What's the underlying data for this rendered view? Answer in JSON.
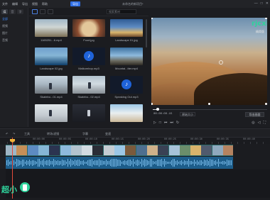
{
  "titlebar": {
    "menus": [
      "文件",
      "编辑",
      "导出",
      "视图",
      "帮助"
    ],
    "export_button": "导出",
    "title": "未命名的新项目*",
    "controls": [
      "—",
      "□",
      "✕"
    ]
  },
  "sidebar": {
    "tabs": [
      "媒",
      "音",
      "字"
    ],
    "items": [
      "全部",
      "视频",
      "图片",
      "音频"
    ]
  },
  "media": {
    "search_placeholder": "搜索素材",
    "items": [
      {
        "name": "1165251...6.mp4",
        "thumb": "sky"
      },
      {
        "name": "Food.jpg",
        "thumb": "food"
      },
      {
        "name": "Landscape 01.jpg",
        "thumb": "land"
      },
      {
        "name": "Landscape 02.jpg",
        "thumb": "sea"
      },
      {
        "name": "Malkombop.mp3",
        "thumb": "audio"
      },
      {
        "name": "Mountai...tter.mp4",
        "thumb": "mtn"
      },
      {
        "name": "Skatebo...01.mp4",
        "thumb": "skate1"
      },
      {
        "name": "Skatebo...02.mp4",
        "thumb": "skate2"
      },
      {
        "name": "Speaking Out.mp3",
        "thumb": "audio"
      },
      {
        "name": "",
        "thumb": "run"
      },
      {
        "name": "",
        "thumb": "dark"
      },
      {
        "name": "",
        "thumb": "beach"
      }
    ]
  },
  "preview": {
    "logo": "rjcxb",
    "logo_sub": "精简版",
    "time": "00:00:00.15",
    "quality": "原始大小",
    "export_label": "导出画面",
    "progress": 0.04
  },
  "timeline": {
    "tools": [
      "工具",
      "转场/滤镜",
      "字幕",
      "变速"
    ],
    "ruler_labels": [
      "00:00:00",
      "00:00:05",
      "00:00:10",
      "00:00:15",
      "00:00:20",
      "00:00:25",
      "00:00:30",
      "00:00:35",
      "00:00:40",
      "00:00:45"
    ]
  },
  "watermark": "超小"
}
